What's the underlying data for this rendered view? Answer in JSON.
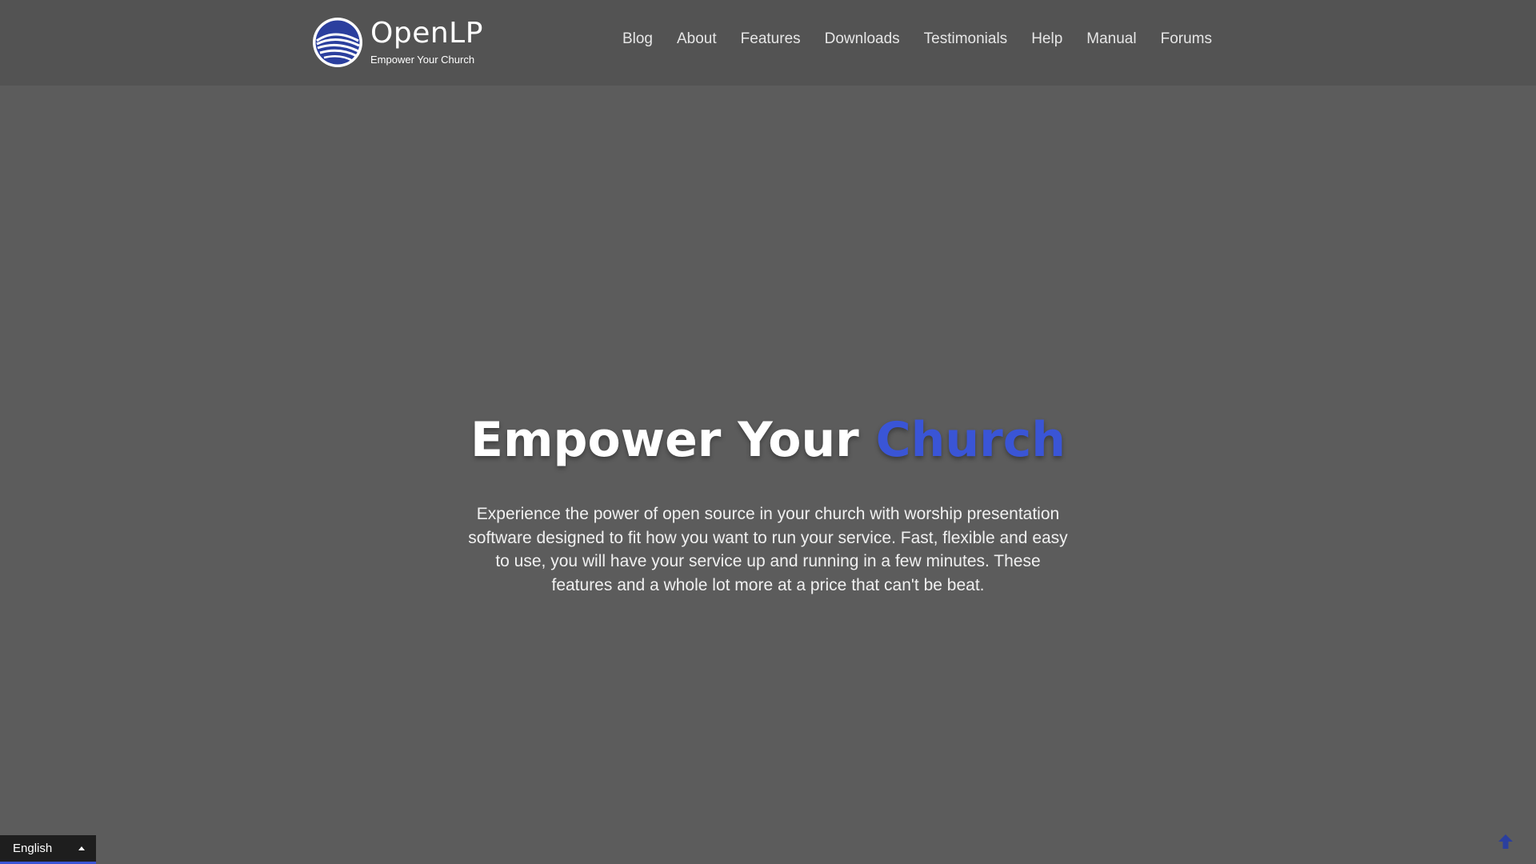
{
  "header": {
    "brand_name": "OpenLP",
    "brand_tagline": "Empower Your Church",
    "logo_icon": "openlp-logo-icon",
    "nav": [
      {
        "label": "Blog"
      },
      {
        "label": "About"
      },
      {
        "label": "Features"
      },
      {
        "label": "Downloads"
      },
      {
        "label": "Testimonials"
      },
      {
        "label": "Help"
      },
      {
        "label": "Manual"
      },
      {
        "label": "Forums"
      }
    ]
  },
  "hero": {
    "title_main": "Empower Your",
    "title_accent": "Church",
    "description": "Experience the power of open source in your church with worship presentation software designed to fit how you want to run your service. Fast, flexible and easy to use, you will have your service up and running in a few minutes. These features and a whole lot more at a price that can't be beat."
  },
  "language_selector": {
    "selected": "English",
    "icon": "caret-up-icon"
  },
  "back_to_top": {
    "icon": "arrow-up-icon"
  },
  "colors": {
    "background": "#5c5c5c",
    "header_background": "#535353",
    "accent": "#3a55d6",
    "text": "#ffffff"
  }
}
